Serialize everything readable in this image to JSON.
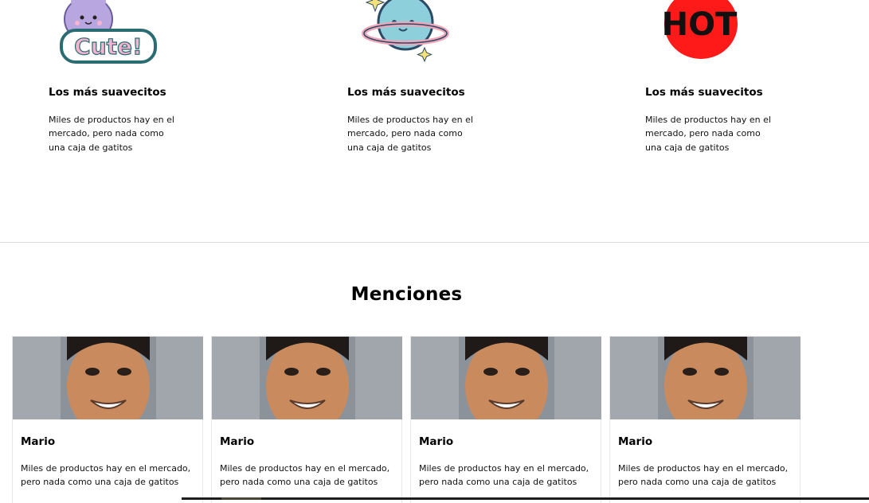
{
  "features": [
    {
      "sticker_text": "Cute!",
      "sticker": "cute-sticker",
      "title": "Los más suavecitos",
      "description": "Miles de productos hay en el mercado, pero nada como una caja de gatitos"
    },
    {
      "sticker": "planet-sticker",
      "title": "Los más suavecitos",
      "description": "Miles de productos hay en el mercado, pero nada como una caja de gatitos"
    },
    {
      "sticker_text": "HOT",
      "sticker": "hot-sticker",
      "title": "Los más suavecitos",
      "description": "Miles de productos hay en el mercado, pero nada como una caja de gatitos"
    }
  ],
  "mentions": {
    "title": "Menciones",
    "cards": [
      {
        "name": "Mario",
        "text": "Miles de productos hay en el mercado, pero nada como una caja de gatitos"
      },
      {
        "name": "Mario",
        "text": "Miles de productos hay en el mercado, pero nada como una caja de gatitos"
      },
      {
        "name": "Mario",
        "text": "Miles de productos hay en el mercado, pero nada como una caja de gatitos"
      },
      {
        "name": "Mario",
        "text": "Miles de productos hay en el mercado, pero nada como una caja de gatitos"
      }
    ]
  },
  "colors": {
    "hot_red": "#ff1a1a",
    "planet_blue": "#8ecfdc",
    "cute_purple": "#b8a6e0",
    "cute_pink": "#f7b3cf"
  }
}
